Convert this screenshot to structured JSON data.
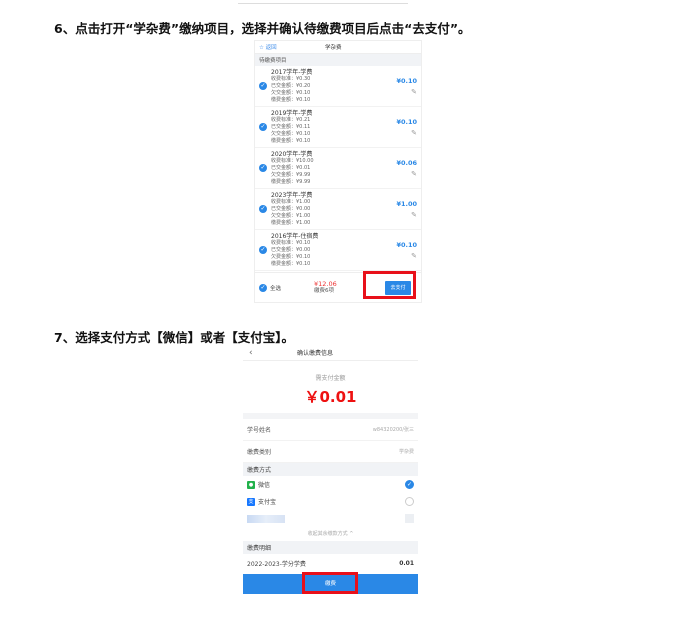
{
  "step6": {
    "text": "6、点击打开“学杂费”缴纳项目，选择并确认待缴费项目后点击“去支付”。"
  },
  "step7": {
    "text": "7、选择支付方式【微信】或者【支付宝】。"
  },
  "screen1": {
    "back": "☆ 返回",
    "title": "学杂费",
    "section": "待缴费项目",
    "items": [
      {
        "name": "2017学年-学费",
        "rows": [
          "收费标准：¥0.30",
          "已交金额：¥0.20",
          "欠交金额：¥0.10",
          "缴费金额：¥0.10"
        ],
        "amount": "¥0.10"
      },
      {
        "name": "2019学年-学费",
        "rows": [
          "收费标准：¥0.21",
          "已交金额：¥0.11",
          "欠交金额：¥0.10",
          "缴费金额：¥0.10"
        ],
        "amount": "¥0.10"
      },
      {
        "name": "2020学年-学费",
        "rows": [
          "收费标准：¥10.00",
          "已交金额：¥0.01",
          "欠交金额：¥9.99",
          "缴费金额：¥9.99"
        ],
        "amount": "¥0.06"
      },
      {
        "name": "2023学年-学费",
        "rows": [
          "收费标准：¥1.00",
          "已交金额：¥0.00",
          "欠交金额：¥1.00",
          "缴费金额：¥1.00"
        ],
        "amount": "¥1.00"
      },
      {
        "name": "2016学年-住宿费",
        "rows": [
          "收费标准：¥0.10",
          "已交金额：¥0.00",
          "欠费金额：¥0.10",
          "缴费金额：¥0.10"
        ],
        "amount": "¥0.10"
      }
    ],
    "footer": {
      "select_all": "全选",
      "total": "¥12.06",
      "count": "缴费6项",
      "pay_button": "去支付"
    }
  },
  "screen2": {
    "back": "‹",
    "title": "确认缴费信息",
    "amount_label": "需支付金额",
    "amount": "￥0.01",
    "rows": [
      {
        "k": "学号姓名",
        "v": "w84320200/张三"
      },
      {
        "k": "缴费类别",
        "v": "学杂费"
      }
    ],
    "pay_method_label": "缴费方式",
    "methods": [
      {
        "name": "微信",
        "selected": true
      },
      {
        "name": "支付宝",
        "selected": false
      }
    ],
    "expand": "收起其余缴款方式 ^",
    "detail_label": "缴费明细",
    "detail": {
      "name": "2022-2023-学分学费",
      "value": "0.01"
    },
    "pay_button": "缴费"
  }
}
